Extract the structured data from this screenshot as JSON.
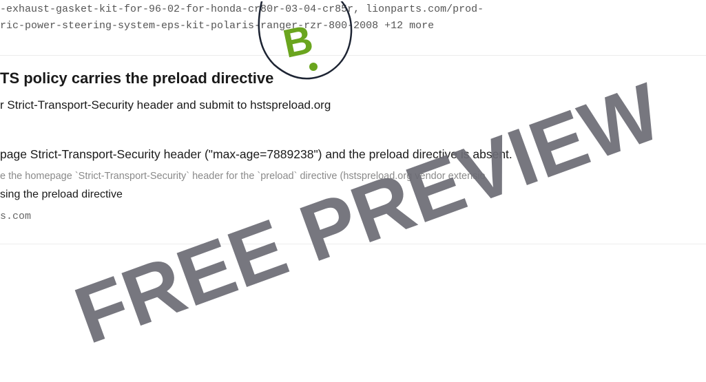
{
  "urls": {
    "line1": "-exhaust-gasket-kit-for-96-02-for-honda-cr80r-03-04-cr85r, lionparts.com/prod-",
    "line2": "ric-power-steering-system-eps-kit-polaris-ranger-rzr-800-2008",
    "more": "+12 more"
  },
  "badge": {
    "letter": "B",
    "color": "#6aa51e"
  },
  "issue": {
    "title": "TS policy carries the preload directive",
    "recommendation": "r Strict-Transport-Security header and submit to hstspreload.org",
    "finding": "page Strict-Transport-Security header (\"max-age=7889238\") and the preload directive is absent.",
    "check": "e the homepage `Strict-Transport-Security` header for the `preload` directive (hstspreload.org vendor extensio",
    "status": "sing the preload directive",
    "host": "s.com"
  },
  "watermark": {
    "text": "FREE PREVIEW",
    "color": "#6b6b74"
  }
}
